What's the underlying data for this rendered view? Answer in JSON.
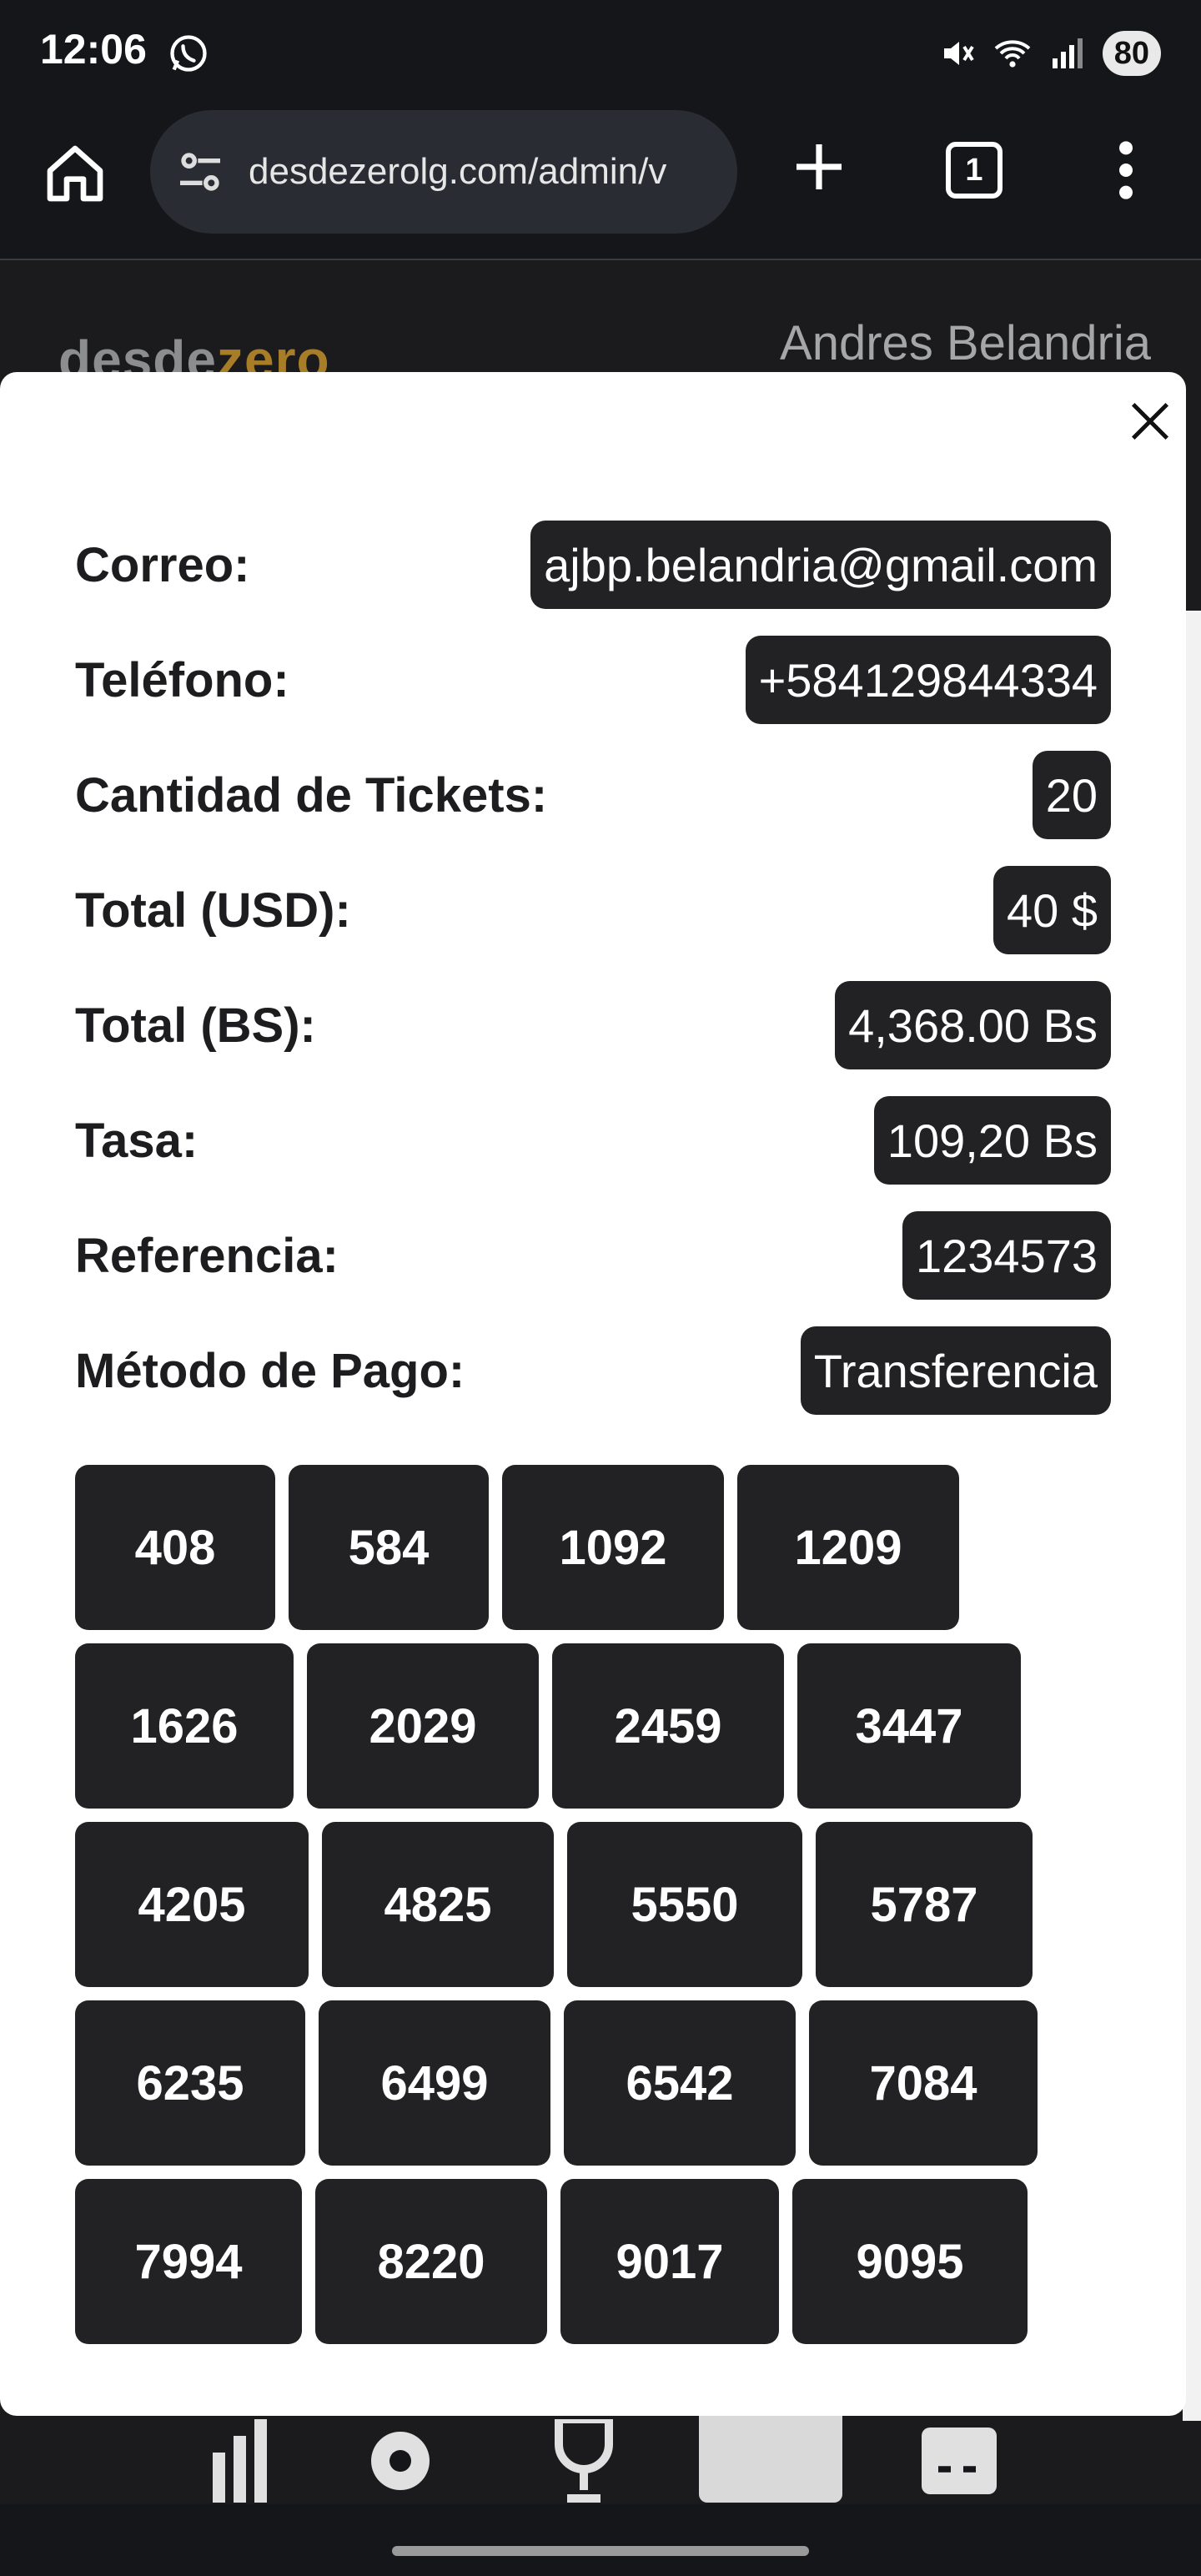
{
  "status_bar": {
    "time": "12:06",
    "battery": "80",
    "icons": [
      "whatsapp-icon",
      "mute-icon",
      "wifi-icon",
      "signal-icon"
    ]
  },
  "browser": {
    "url": "desdezerolg.com/admin/v",
    "tab_count": "1",
    "icons": [
      "home-icon",
      "site-settings-icon",
      "new-tab-icon",
      "menu-icon"
    ]
  },
  "page": {
    "logo_prefix": "desde",
    "logo_suffix": "zero",
    "user_name": "Andres Belandria"
  },
  "modal": {
    "fields": [
      {
        "label": "Correo:",
        "value": "ajbp.belandria@gmail.com"
      },
      {
        "label": "Teléfono:",
        "value": "+584129844334"
      },
      {
        "label": "Cantidad de Tickets:",
        "value": "20"
      },
      {
        "label": "Total (USD):",
        "value": "40 $"
      },
      {
        "label": "Total (BS):",
        "value": "4,368.00 Bs"
      },
      {
        "label": "Tasa:",
        "value": "109,20 Bs"
      },
      {
        "label": "Referencia:",
        "value": "1234573"
      },
      {
        "label": "Método de Pago:",
        "value": "Transferencia"
      }
    ],
    "tickets": [
      "408",
      "584",
      "1092",
      "1209",
      "1626",
      "2029",
      "2459",
      "3447",
      "4205",
      "4825",
      "5550",
      "5787",
      "6235",
      "6499",
      "6542",
      "7084",
      "7994",
      "8220",
      "9017",
      "9095"
    ]
  },
  "bottom_nav": {
    "items": [
      "stats-icon",
      "settings-icon",
      "trophy-icon",
      "tickets-icon",
      "payments-icon"
    ],
    "active": "tickets-icon"
  },
  "colors": {
    "background": "#15161a",
    "modal": "#ffffff",
    "chip": "#222224",
    "brand_gold": "#a87d28"
  }
}
